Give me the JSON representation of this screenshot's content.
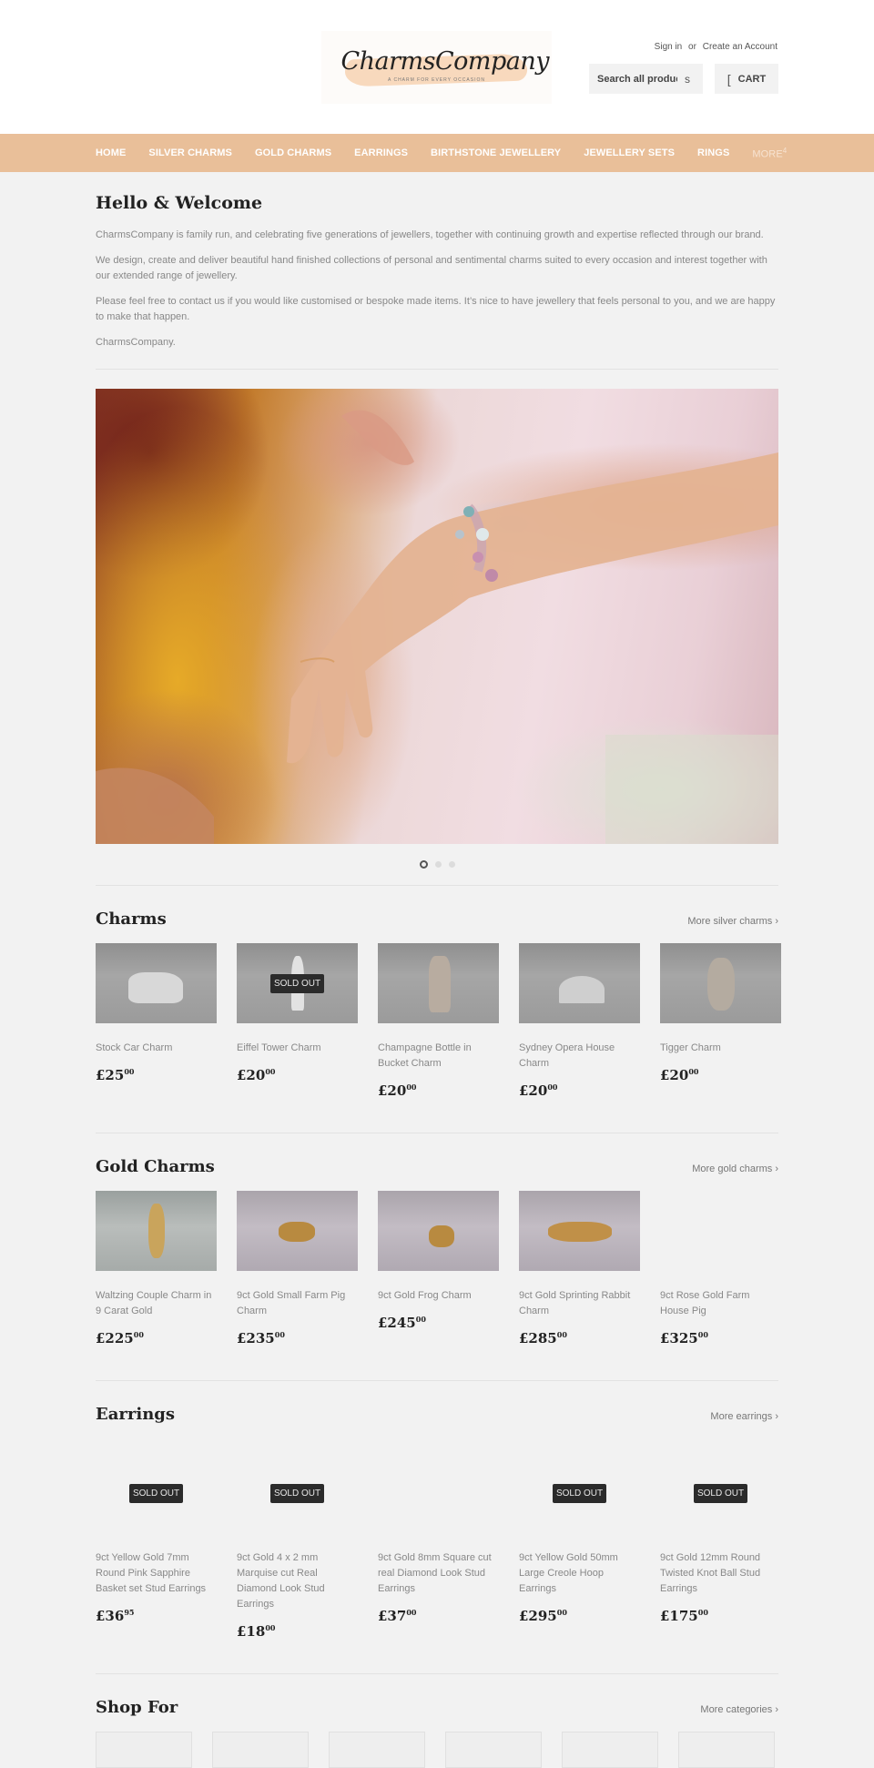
{
  "header": {
    "logo": {
      "name": "CharmsCompany",
      "tagline": "A CHARM FOR EVERY OCCASION"
    },
    "account": {
      "sign_in": "Sign in",
      "or": "or",
      "create_account": "Create an Account"
    },
    "search": {
      "placeholder": "Search all products...",
      "value": "Search all produc",
      "button_glyph": "s"
    },
    "cart": {
      "icon_glyph": "[",
      "label": "CART"
    }
  },
  "nav": {
    "items": [
      {
        "label": "HOME"
      },
      {
        "label": "SILVER CHARMS"
      },
      {
        "label": "GOLD CHARMS"
      },
      {
        "label": "EARRINGS"
      },
      {
        "label": "BIRTHSTONE JEWELLERY"
      },
      {
        "label": "JEWELLERY SETS"
      },
      {
        "label": "RINGS"
      }
    ],
    "more": {
      "label": "MORE",
      "glyph": "4"
    }
  },
  "welcome": {
    "title": "Hello & Welcome",
    "paragraphs": [
      "CharmsCompany is family run, and celebrating five generations of jewellers, together with continuing growth and expertise reflected through our brand.",
      "We design, create and deliver beautiful hand finished collections of personal and sentimental charms suited to every occasion and interest together with our extended range of jewellery.",
      "Please feel free to contact us if you would like customised or bespoke made items. It’s nice to have jewellery that feels personal to you, and we are happy to make that happen.",
      "CharmsCompany."
    ]
  },
  "slideshow": {
    "slides": 3,
    "active": 1
  },
  "sections": {
    "charms": {
      "title": "Charms",
      "more_link": "More silver charms ›",
      "products": [
        {
          "title": "Stock Car Charm",
          "price_main": "£25",
          "price_cents": "00",
          "sold_out": false
        },
        {
          "title": "Eiffel Tower Charm",
          "price_main": "£20",
          "price_cents": "00",
          "sold_out": true
        },
        {
          "title": "Champagne Bottle in Bucket Charm",
          "price_main": "£20",
          "price_cents": "00",
          "sold_out": false
        },
        {
          "title": "Sydney Opera House Charm",
          "price_main": "£20",
          "price_cents": "00",
          "sold_out": false
        },
        {
          "title": "Tigger Charm",
          "price_main": "£20",
          "price_cents": "00",
          "sold_out": false
        }
      ]
    },
    "gold": {
      "title": "Gold Charms",
      "more_link": "More gold charms ›",
      "products": [
        {
          "title": "Waltzing Couple Charm in 9 Carat Gold",
          "price_main": "£225",
          "price_cents": "00",
          "sold_out": false
        },
        {
          "title": "9ct Gold Small Farm Pig Charm",
          "price_main": "£235",
          "price_cents": "00",
          "sold_out": false
        },
        {
          "title": "9ct Gold Frog Charm",
          "price_main": "£245",
          "price_cents": "00",
          "sold_out": false
        },
        {
          "title": "9ct Gold Sprinting Rabbit Charm",
          "price_main": "£285",
          "price_cents": "00",
          "sold_out": false
        },
        {
          "title": "9ct Rose Gold Farm House Pig",
          "price_main": "£325",
          "price_cents": "00",
          "sold_out": false
        }
      ]
    },
    "earrings": {
      "title": "Earrings",
      "more_link": "More earrings ›",
      "products": [
        {
          "title": "9ct Yellow Gold 7mm Round Pink Sapphire Basket set Stud Earrings",
          "price_main": "£36",
          "price_cents": "95",
          "sold_out": true
        },
        {
          "title": "9ct Gold 4 x 2 mm Marquise cut Real Diamond Look Stud Earrings",
          "price_main": "£18",
          "price_cents": "00",
          "sold_out": true
        },
        {
          "title": "9ct Gold 8mm Square cut real Diamond Look Stud Earrings",
          "price_main": "£37",
          "price_cents": "00",
          "sold_out": false
        },
        {
          "title": "9ct Yellow Gold 50mm Large Creole Hoop Earrings",
          "price_main": "£295",
          "price_cents": "00",
          "sold_out": true
        },
        {
          "title": "9ct Gold 12mm Round Twisted Knot Ball Stud Earrings",
          "price_main": "£175",
          "price_cents": "00",
          "sold_out": true
        }
      ]
    },
    "shop_for": {
      "title": "Shop For",
      "more_link": "More categories ›",
      "category_count": 6
    }
  },
  "labels": {
    "sold_out": "SOLD OUT"
  },
  "colors": {
    "nav_bg": "#e9bf99",
    "page_bg": "#f2f2f2",
    "badge_bg": "#2b2b2b"
  }
}
